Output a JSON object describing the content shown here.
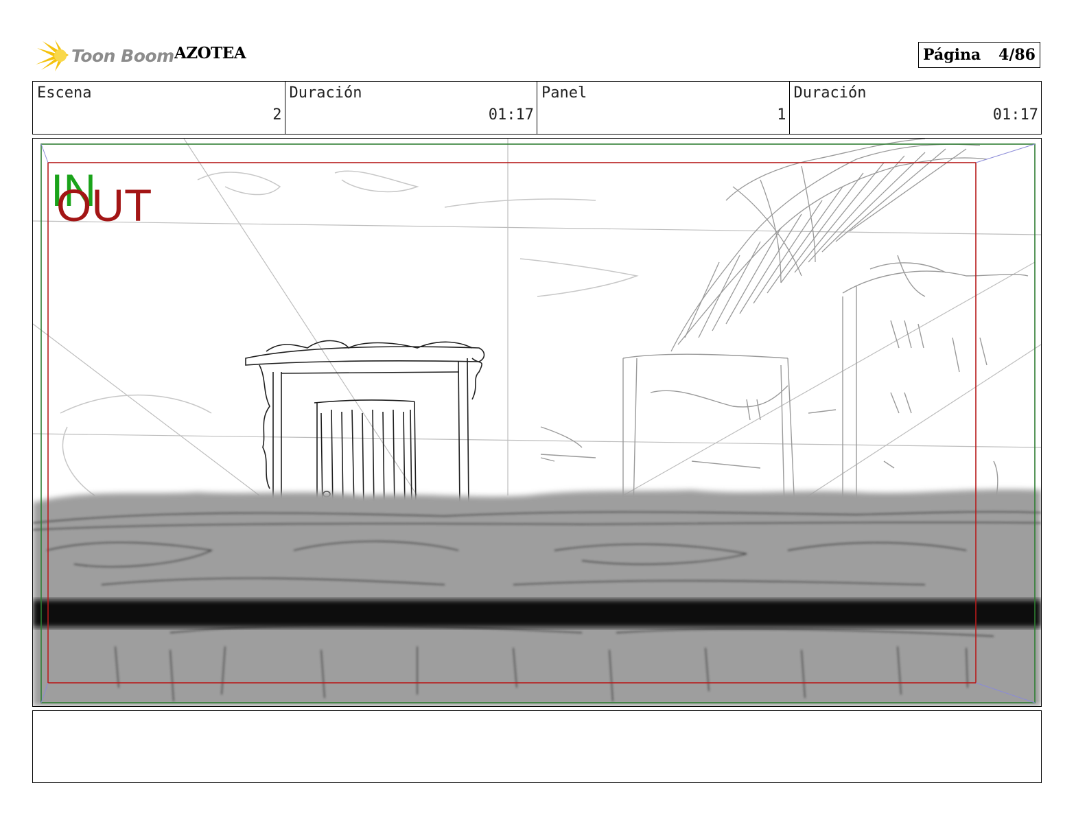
{
  "header": {
    "logo_text": "Toon Boom",
    "project_title": "AZOTEA",
    "page_label": "Página",
    "page_value": "4/86"
  },
  "info": [
    {
      "label": "Escena",
      "value": "2"
    },
    {
      "label": "Duración",
      "value": "01:17"
    },
    {
      "label": "Panel",
      "value": "1"
    },
    {
      "label": "Duración",
      "value": "01:17"
    }
  ],
  "panel": {
    "in_label": "IN",
    "out_label": "OUT",
    "colors": {
      "in": "#1aa31a",
      "out": "#a31515",
      "frame_green": "#2e7d32",
      "frame_red": "#b71c1c"
    }
  },
  "notes": ""
}
